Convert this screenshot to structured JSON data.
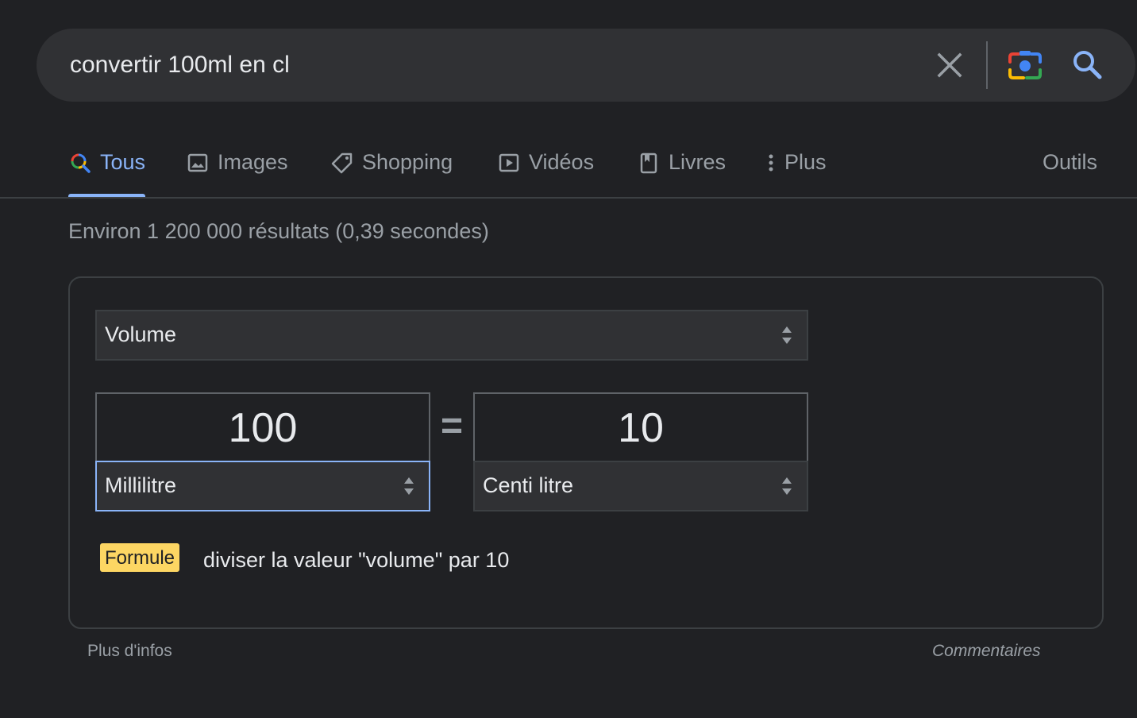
{
  "search": {
    "query": "convertir 100ml en cl",
    "icons": {
      "clear": "close-icon",
      "lens": "camera-lens-icon",
      "submit": "search-icon"
    }
  },
  "tabs": [
    {
      "label": "Tous",
      "icon": "search-multicolor-icon",
      "active": true
    },
    {
      "label": "Images",
      "icon": "image-icon"
    },
    {
      "label": "Shopping",
      "icon": "tag-icon"
    },
    {
      "label": "Vidéos",
      "icon": "play-icon"
    },
    {
      "label": "Livres",
      "icon": "book-icon"
    },
    {
      "label": "Plus",
      "icon": "more-vert-icon"
    }
  ],
  "tools_label": "Outils",
  "result_stats": "Environ 1 200 000 résultats (0,39 secondes)",
  "converter": {
    "unit_type": "Volume",
    "from_value": "100",
    "to_value": "10",
    "equals": "=",
    "from_unit": "Millilitre",
    "to_unit": "Centi litre",
    "formula_label": "Formule",
    "formula_text": "diviser la valeur \"volume\" par 10"
  },
  "footer": {
    "more_info": "Plus d'infos",
    "feedback": "Commentaires"
  },
  "colors": {
    "background": "#202124",
    "surface": "#303134",
    "accent": "#8ab4f8",
    "formula_badge": "#fdd663",
    "muted_text": "#9aa0a6"
  }
}
